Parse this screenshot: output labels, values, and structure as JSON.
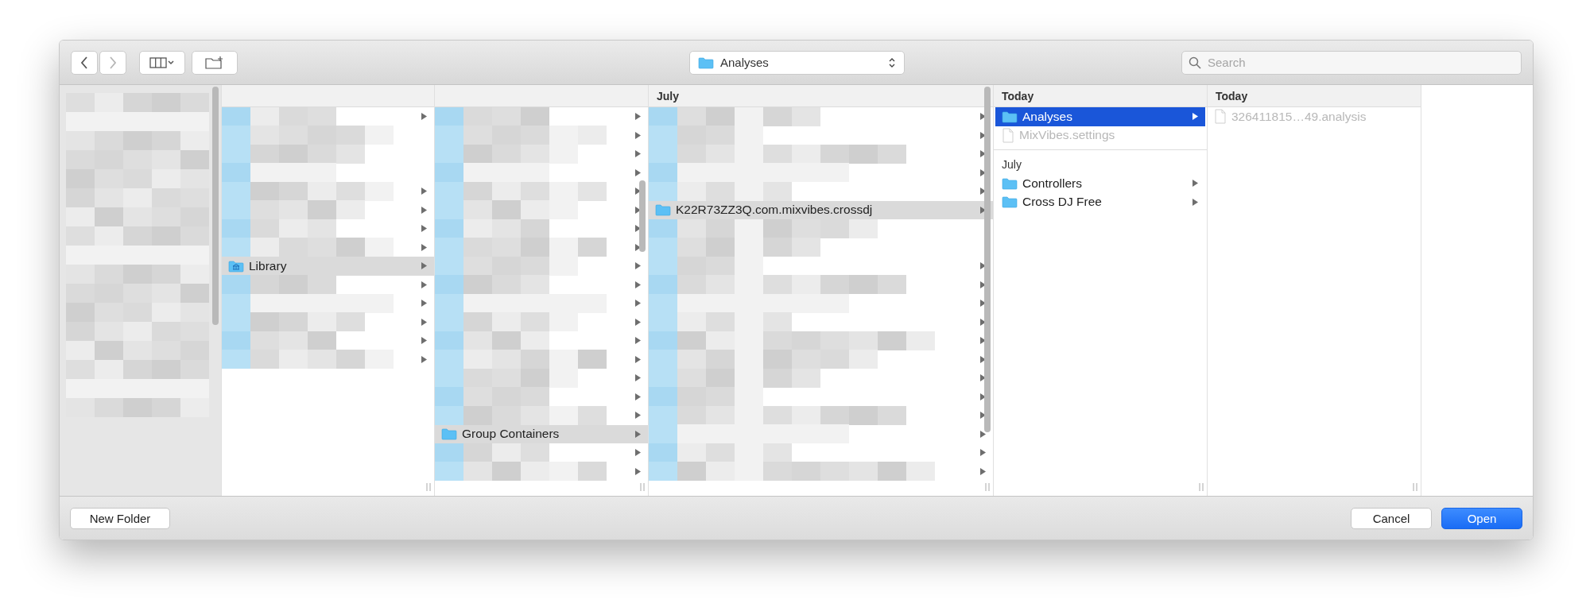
{
  "toolbar": {
    "back_enabled": true,
    "forward_enabled": false,
    "location": "Analyses",
    "search": {
      "placeholder": "Search"
    }
  },
  "columns": [
    {
      "kind": "sidebar"
    },
    {
      "kind": "list",
      "focused": false,
      "items": [
        {
          "kind": "redacted",
          "arrow": true
        },
        {
          "kind": "redacted",
          "arrow": false
        },
        {
          "kind": "redacted",
          "arrow": false
        },
        {
          "kind": "redacted",
          "arrow": false
        },
        {
          "kind": "redacted",
          "arrow": true
        },
        {
          "kind": "redacted",
          "arrow": true
        },
        {
          "kind": "redacted",
          "arrow": true
        },
        {
          "kind": "redacted",
          "arrow": true
        },
        {
          "kind": "library",
          "name": "Library",
          "selected": true,
          "disabled": false,
          "arrow": true
        },
        {
          "kind": "redacted",
          "arrow": true
        },
        {
          "kind": "redacted",
          "arrow": true
        },
        {
          "kind": "redacted",
          "arrow": true
        },
        {
          "kind": "redacted",
          "arrow": true
        },
        {
          "kind": "redacted",
          "arrow": true
        }
      ]
    },
    {
      "kind": "list",
      "focused": false,
      "items": [
        {
          "kind": "redacted",
          "arrow": true
        },
        {
          "kind": "redacted",
          "arrow": true
        },
        {
          "kind": "redacted",
          "arrow": true
        },
        {
          "kind": "redacted",
          "arrow": true
        },
        {
          "kind": "redacted",
          "arrow": true
        },
        {
          "kind": "redacted",
          "arrow": true
        },
        {
          "kind": "redacted",
          "arrow": true
        },
        {
          "kind": "redacted",
          "arrow": true
        },
        {
          "kind": "redacted",
          "arrow": true
        },
        {
          "kind": "redacted",
          "arrow": true
        },
        {
          "kind": "redacted",
          "arrow": true
        },
        {
          "kind": "redacted",
          "arrow": true
        },
        {
          "kind": "redacted",
          "arrow": true
        },
        {
          "kind": "redacted",
          "arrow": true
        },
        {
          "kind": "redacted",
          "arrow": true
        },
        {
          "kind": "redacted",
          "arrow": true
        },
        {
          "kind": "redacted",
          "arrow": true
        },
        {
          "kind": "folder",
          "name": "Group Containers",
          "selected": true,
          "disabled": false,
          "arrow": true
        },
        {
          "kind": "redacted",
          "arrow": true
        },
        {
          "kind": "redacted",
          "arrow": true
        }
      ]
    },
    {
      "kind": "list",
      "focused": false,
      "header": "July",
      "items": [
        {
          "kind": "redacted",
          "arrow": true
        },
        {
          "kind": "redacted",
          "arrow": true
        },
        {
          "kind": "redacted",
          "arrow": true
        },
        {
          "kind": "redacted",
          "arrow": true
        },
        {
          "kind": "redacted",
          "arrow": true
        },
        {
          "kind": "folder",
          "name": "K22R73ZZ3Q.com.mixvibes.crossdj",
          "selected": true,
          "disabled": false,
          "arrow": true
        },
        {
          "kind": "redacted",
          "arrow": false
        },
        {
          "kind": "redacted",
          "arrow": false
        },
        {
          "kind": "redacted",
          "arrow": true
        },
        {
          "kind": "redacted",
          "arrow": true
        },
        {
          "kind": "redacted",
          "arrow": true
        },
        {
          "kind": "redacted",
          "arrow": true
        },
        {
          "kind": "redacted",
          "arrow": true
        },
        {
          "kind": "redacted",
          "arrow": true
        },
        {
          "kind": "redacted",
          "arrow": true
        },
        {
          "kind": "redacted",
          "arrow": true
        },
        {
          "kind": "redacted",
          "arrow": true
        },
        {
          "kind": "redacted",
          "arrow": true
        },
        {
          "kind": "redacted",
          "arrow": true
        },
        {
          "kind": "redacted",
          "arrow": true
        }
      ]
    },
    {
      "kind": "list",
      "focused": true,
      "header": "Today",
      "items": [
        {
          "kind": "folder",
          "name": "Analyses",
          "selected": true,
          "disabled": false,
          "arrow": true
        },
        {
          "kind": "file",
          "name": "MixVibes.settings",
          "selected": false,
          "disabled": true,
          "arrow": false
        },
        {
          "kind": "section",
          "name": "July"
        },
        {
          "kind": "folder",
          "name": "Controllers",
          "selected": false,
          "disabled": false,
          "arrow": true
        },
        {
          "kind": "folder",
          "name": "Cross DJ Free",
          "selected": false,
          "disabled": false,
          "arrow": true
        }
      ]
    },
    {
      "kind": "list",
      "header": "Today",
      "items": [
        {
          "kind": "file",
          "name": "326411815…49.analysis",
          "selected": false,
          "disabled": true,
          "arrow": false
        }
      ]
    }
  ],
  "buttons": {
    "new_folder": "New Folder",
    "cancel": "Cancel",
    "open": "Open"
  }
}
